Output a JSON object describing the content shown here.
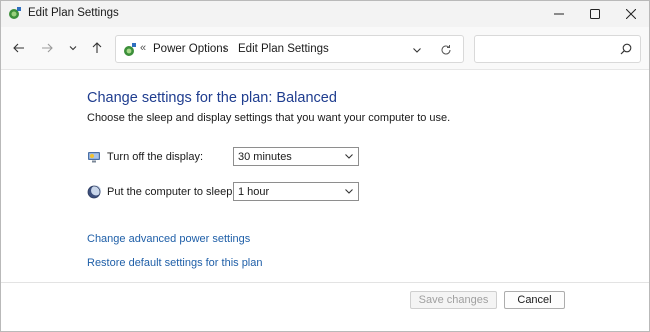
{
  "window": {
    "title": "Edit Plan Settings",
    "controls": {
      "minimize": "minimize",
      "maximize": "maximize",
      "close": "close"
    }
  },
  "navigation": {
    "icons": [
      "back-arrow-icon",
      "forward-arrow-icon",
      "chevron-down-icon",
      "up-arrow-icon"
    ]
  },
  "address_bar": {
    "separator": "«",
    "breadcrumbs": [
      "Power Options",
      "Edit Plan Settings"
    ],
    "crumb_arrow": "›"
  },
  "search": {
    "placeholder": ""
  },
  "content": {
    "heading": "Change settings for the plan: Balanced",
    "description": "Choose the sleep and display settings that you want your computer to use.",
    "settings": [
      {
        "label": "Turn off the display:",
        "value": "30 minutes",
        "icon": "monitor-icon"
      },
      {
        "label": "Put the computer to sleep:",
        "value": "1 hour",
        "icon": "moon-icon"
      }
    ],
    "links": {
      "advanced": "Change advanced power settings",
      "restore": "Restore default settings for this plan"
    }
  },
  "footer": {
    "save_label": "Save changes",
    "cancel_label": "Cancel",
    "save_enabled": false
  },
  "colors": {
    "heading": "#1f3d8f",
    "link": "#1f5fa8",
    "titlebar": "#f3f3f3"
  }
}
